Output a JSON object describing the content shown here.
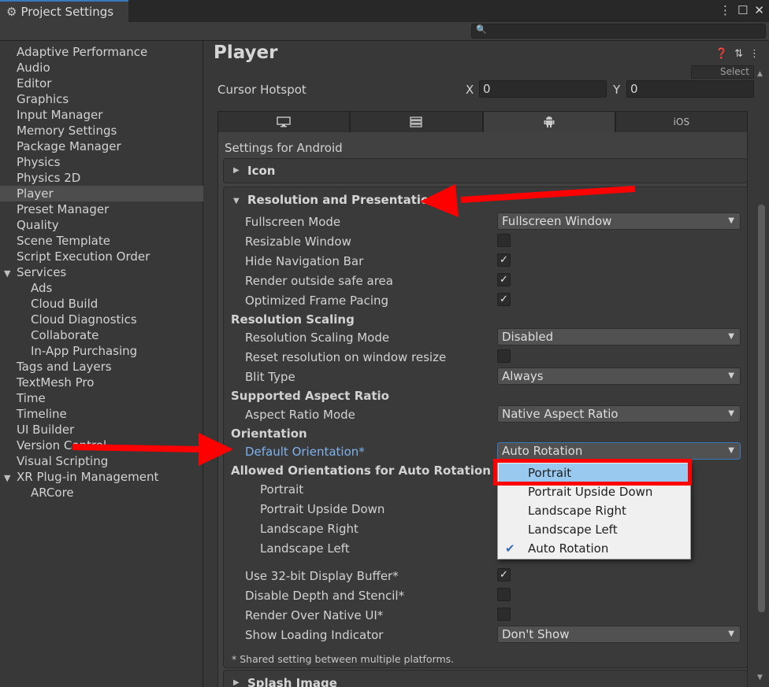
{
  "window": {
    "tab_title": "Project Settings",
    "tab_icon": "gear-icon"
  },
  "sidebar": {
    "items": [
      {
        "label": "Adaptive Performance"
      },
      {
        "label": "Audio"
      },
      {
        "label": "Editor"
      },
      {
        "label": "Graphics"
      },
      {
        "label": "Input Manager"
      },
      {
        "label": "Memory Settings"
      },
      {
        "label": "Package Manager"
      },
      {
        "label": "Physics"
      },
      {
        "label": "Physics 2D"
      },
      {
        "label": "Player"
      },
      {
        "label": "Preset Manager"
      },
      {
        "label": "Quality"
      },
      {
        "label": "Scene Template"
      },
      {
        "label": "Script Execution Order"
      },
      {
        "label": "Services"
      },
      {
        "label": "Ads"
      },
      {
        "label": "Cloud Build"
      },
      {
        "label": "Cloud Diagnostics"
      },
      {
        "label": "Collaborate"
      },
      {
        "label": "In-App Purchasing"
      },
      {
        "label": "Tags and Layers"
      },
      {
        "label": "TextMesh Pro"
      },
      {
        "label": "Time"
      },
      {
        "label": "Timeline"
      },
      {
        "label": "UI Builder"
      },
      {
        "label": "Version Control"
      },
      {
        "label": "Visual Scripting"
      },
      {
        "label": "XR Plug-in Management"
      },
      {
        "label": "ARCore"
      }
    ],
    "selected": "Player"
  },
  "main": {
    "title": "Player",
    "select_label": "Select",
    "cursor_hotspot": {
      "label": "Cursor Hotspot",
      "x_label": "X",
      "x_value": "0",
      "y_label": "Y",
      "y_value": "0"
    },
    "platform_tabs": [
      {
        "icon": "monitor-icon"
      },
      {
        "icon": "server-icon"
      },
      {
        "icon": "android-icon"
      },
      {
        "label": "iOS"
      }
    ],
    "settings_for": "Settings for Android",
    "icon_section": "Icon",
    "resolution_section": "Resolution and Presentation",
    "fullscreen_mode": {
      "label": "Fullscreen Mode",
      "value": "Fullscreen Window"
    },
    "resizable_window": {
      "label": "Resizable Window",
      "checked": false
    },
    "hide_nav_bar": {
      "label": "Hide Navigation Bar",
      "checked": true
    },
    "render_outside_safe": {
      "label": "Render outside safe area",
      "checked": true
    },
    "optimized_frame_pacing": {
      "label": "Optimized Frame Pacing",
      "checked": true
    },
    "resolution_scaling_header": "Resolution Scaling",
    "resolution_scaling_mode": {
      "label": "Resolution Scaling Mode",
      "value": "Disabled"
    },
    "reset_resolution": {
      "label": "Reset resolution on window resize",
      "checked": false
    },
    "blit_type": {
      "label": "Blit Type",
      "value": "Always"
    },
    "aspect_ratio_header": "Supported Aspect Ratio",
    "aspect_ratio_mode": {
      "label": "Aspect Ratio Mode",
      "value": "Native Aspect Ratio"
    },
    "orientation_header": "Orientation",
    "default_orientation": {
      "label": "Default Orientation*",
      "value": "Auto Rotation"
    },
    "allowed_orientations_header": "Allowed Orientations for Auto Rotation",
    "allowed": {
      "portrait": "Portrait",
      "portrait_upside_down": "Portrait Upside Down",
      "landscape_right": "Landscape Right",
      "landscape_left": "Landscape Left"
    },
    "use_32bit": {
      "label": "Use 32-bit Display Buffer*",
      "checked": true
    },
    "disable_depth": {
      "label": "Disable Depth and Stencil*",
      "checked": false
    },
    "render_over_native": {
      "label": "Render Over Native UI*",
      "checked": false
    },
    "loading_indicator": {
      "label": "Show Loading Indicator",
      "value": "Don't Show"
    },
    "shared_note": "* Shared setting between multiple platforms.",
    "splash_section": "Splash Image"
  },
  "popup": {
    "options": [
      "Portrait",
      "Portrait Upside Down",
      "Landscape Right",
      "Landscape Left",
      "Auto Rotation"
    ],
    "highlighted": "Portrait",
    "checked": "Auto Rotation"
  },
  "colors": {
    "annotation_red": "#ff0000",
    "highlight_blue": "#99c9ef",
    "accent_blue": "#3a79bb",
    "link_blue": "#7fb1ec"
  }
}
